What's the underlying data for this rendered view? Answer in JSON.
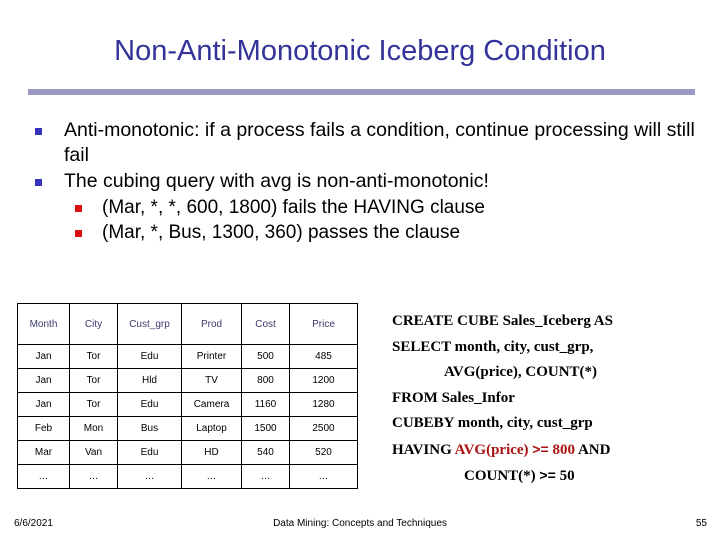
{
  "slide": {
    "title": "Non-Anti-Monotonic Iceberg Condition",
    "accent_rule_color": "#9a9ac4",
    "title_color": "#333399"
  },
  "bullets": {
    "level1_marker_color": "#3333bb",
    "level2_marker_color": "#dd1111",
    "items": [
      {
        "level": 1,
        "text": "Anti-monotonic: if a process fails a condition, continue processing will still fail"
      },
      {
        "level": 1,
        "text": "The cubing query with avg is non-anti-monotonic!"
      },
      {
        "level": 2,
        "text": "(Mar, *, *, 600, 1800) fails the HAVING clause"
      },
      {
        "level": 2,
        "text": "(Mar, *, Bus, 1300, 360) passes the clause"
      }
    ]
  },
  "table": {
    "headers": [
      "Month",
      "City",
      "Cust_grp",
      "Prod",
      "Cost",
      "Price"
    ],
    "header_color": "#3b3b6d",
    "rows": [
      [
        "Jan",
        "Tor",
        "Edu",
        "Printer",
        "500",
        "485"
      ],
      [
        "Jan",
        "Tor",
        "Hld",
        "TV",
        "800",
        "1200"
      ],
      [
        "Jan",
        "Tor",
        "Edu",
        "Camera",
        "1160",
        "1280"
      ],
      [
        "Feb",
        "Mon",
        "Bus",
        "Laptop",
        "1500",
        "2500"
      ],
      [
        "Mar",
        "Van",
        "Edu",
        "HD",
        "540",
        "520"
      ],
      [
        "…",
        "…",
        "…",
        "…",
        "…",
        "…"
      ]
    ]
  },
  "sql": {
    "highlight_color": "#aa1111",
    "lines": [
      {
        "indent": 0,
        "text": "CREATE CUBE Sales_Iceberg AS"
      },
      {
        "indent": 0,
        "text": "SELECT month, city, cust_grp,"
      },
      {
        "indent": 1,
        "text": "AVG(price), COUNT(*)"
      },
      {
        "indent": 0,
        "text": "FROM Sales_Infor"
      },
      {
        "indent": 0,
        "text": "CUBEBY month, city, cust_grp"
      }
    ],
    "having_prefix": "HAVING ",
    "having_highlight_expr": "AVG(price) ",
    "having_highlight_op": ">= ",
    "having_highlight_value": "800",
    "having_suffix": " AND",
    "count_expr": "COUNT(*) ",
    "count_op": ">= ",
    "count_value": "50"
  },
  "footer": {
    "date": "6/6/2021",
    "center": "Data Mining: Concepts and Techniques",
    "page": "55"
  }
}
